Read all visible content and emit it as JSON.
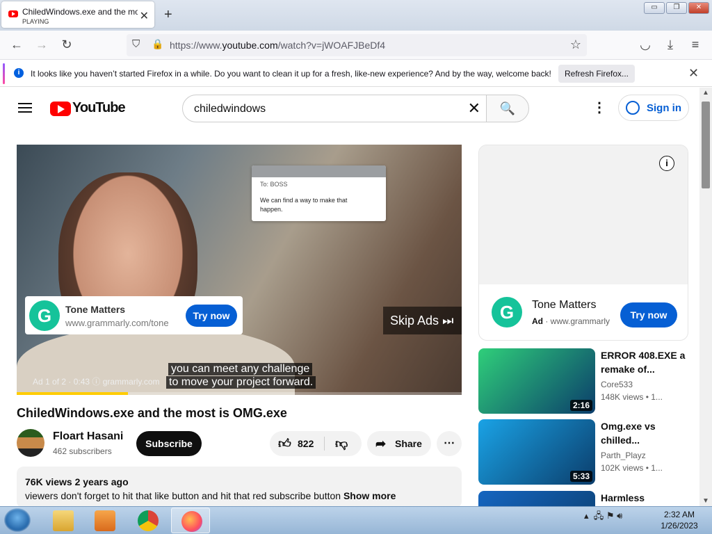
{
  "browser": {
    "tab_title": "ChiledWindows.exe and the most is OMG.exe",
    "tab_status": "PLAYING",
    "url_prefix": "https://www.",
    "url_domain": "youtube.com",
    "url_rest": "/watch?v=jWOAFJBeDf4"
  },
  "infobar": {
    "message": "It looks like you haven’t started Firefox in a while. Do you want to clean it up for a fresh, like-new experience? And by the way, welcome back!",
    "button": "Refresh Firefox..."
  },
  "youtube": {
    "logo_text": "YouTube",
    "search_query": "chiledwindows",
    "signin": "Sign in"
  },
  "video": {
    "email_to": "To: BOSS",
    "email_body": "We can find a way to make that happen.",
    "ad_name": "Tone Matters",
    "ad_site": "www.grammarly.com/tone",
    "ad_button": "Try now",
    "skip": "Skip Ads",
    "ad_info": "Ad 1 of 2 · 0:43",
    "ad_info_site": "grammarly.com",
    "caption_line1": "you can meet any challenge",
    "caption_line2": "to move your project forward.",
    "progress": 0.25,
    "title": "ChiledWindows.exe and the most is OMG.exe",
    "channel": "Floart Hasani",
    "subscribers": "462 subscribers",
    "subscribe": "Subscribe",
    "likes": "822",
    "share": "Share",
    "views_date": "76K views  2 years ago",
    "description": "viewers don't forget to hit that like button and hit that red subscribe button",
    "show_more": "Show more"
  },
  "side_ad": {
    "name": "Tone Matters",
    "ad_label": "Ad",
    "site": "www.grammarly",
    "button": "Try now"
  },
  "recommendations": [
    {
      "title": "ERROR 408.EXE a remake of...",
      "channel": "Core533",
      "views": "148K views",
      "age": "1...",
      "duration": "2:16",
      "color": "#2fcf7a"
    },
    {
      "title": "Omg.exe vs chilled...",
      "channel": "Parth_Playz",
      "views": "102K views",
      "age": "1...",
      "duration": "5:33",
      "color": "#1aa3e6"
    },
    {
      "title": "Harmless",
      "channel": "",
      "views": "",
      "age": "",
      "duration": "",
      "color": "#1565c0"
    }
  ],
  "taskbar": {
    "time": "2:32 AM",
    "date": "1/26/2023"
  },
  "colors": {
    "youtube_red": "#ff0000",
    "accent_blue": "#065fd4",
    "grammarly_green": "#15c39a"
  }
}
